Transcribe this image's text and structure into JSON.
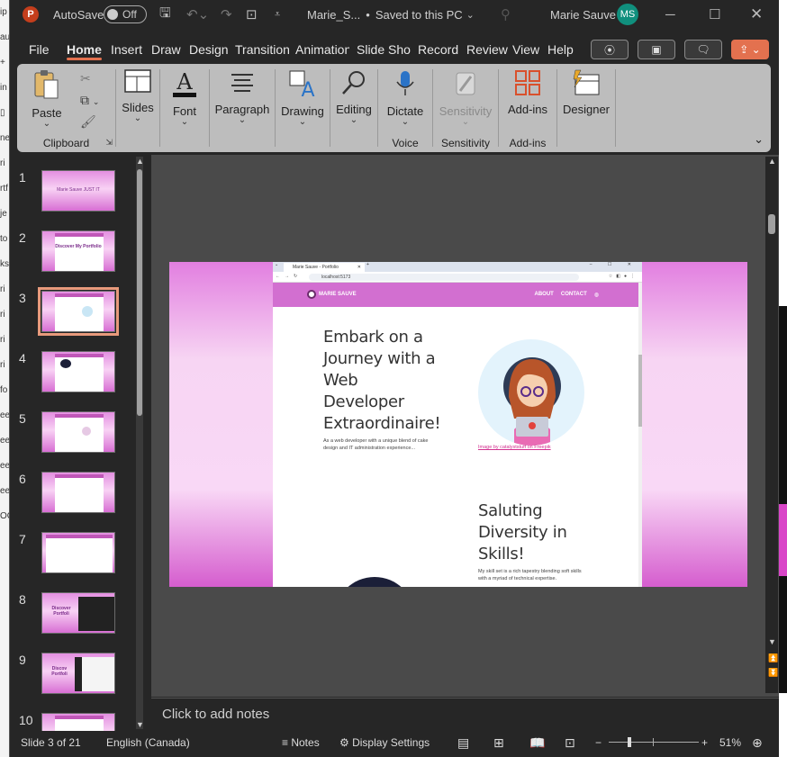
{
  "window": {
    "autosave_label": "AutoSave",
    "autosave_state": "Off",
    "file_name": "Marie_S...",
    "save_status": "Saved to this PC",
    "user_name": "Marie Sauve",
    "user_initials": "MS"
  },
  "menu": {
    "tabs": [
      "File",
      "Home",
      "Insert",
      "Draw",
      "Design",
      "Transition:",
      "Animation",
      "Slide Show",
      "Record",
      "Review",
      "View",
      "Help"
    ],
    "active": "Home"
  },
  "ribbon": {
    "paste": "Paste",
    "clipboard_group": "Clipboard",
    "slides": "Slides",
    "font": "Font",
    "paragraph": "Paragraph",
    "drawing": "Drawing",
    "editing": "Editing",
    "dictate": "Dictate",
    "voice_group": "Voice",
    "sensitivity": "Sensitivity",
    "sensitivity_group": "Sensitivity",
    "addins": "Add-ins",
    "addins_group": "Add-ins",
    "designer": "Designer"
  },
  "thumbnails": [
    {
      "num": "1",
      "title": "Marie Sauve JUST IT"
    },
    {
      "num": "2",
      "title": "Discover My Portfolio"
    },
    {
      "num": "3",
      "title": ""
    },
    {
      "num": "4",
      "title": ""
    },
    {
      "num": "5",
      "title": ""
    },
    {
      "num": "6",
      "title": ""
    },
    {
      "num": "7",
      "title": ""
    },
    {
      "num": "8",
      "title": "Discover Portfoli"
    },
    {
      "num": "9",
      "title": "Discov Portfoli"
    },
    {
      "num": "10",
      "title": ""
    }
  ],
  "slide": {
    "browser_tab": "Marie Sauve - Portfolio",
    "url": "localhost:5173",
    "site_name": "MARIE SAUVE",
    "nav_links": [
      "ABOUT",
      "CONTACT"
    ],
    "hero_heading": "Embark on a Journey with a Web Developer Extraordinaire!",
    "hero_text": "As a web developer with a unique blend of cake design and IT administration experience...",
    "image_credit": "Image by catalyststuff on Freepik",
    "section_heading": "Saluting Diversity in Skills!",
    "section_text": "My skill set is a rich tapestry blending soft skills with a myriad of technical expertise."
  },
  "notes_placeholder": "Click to add notes",
  "status": {
    "slide_counter": "Slide 3 of 21",
    "language": "English (Canada)",
    "notes": "Notes",
    "display_settings": "Display Settings",
    "zoom": "51%",
    "zoom_level_percent": 51
  },
  "colors": {
    "accent": "#e3714f",
    "slide_pink": "#d26fd0",
    "avatar": "#108f7d"
  }
}
